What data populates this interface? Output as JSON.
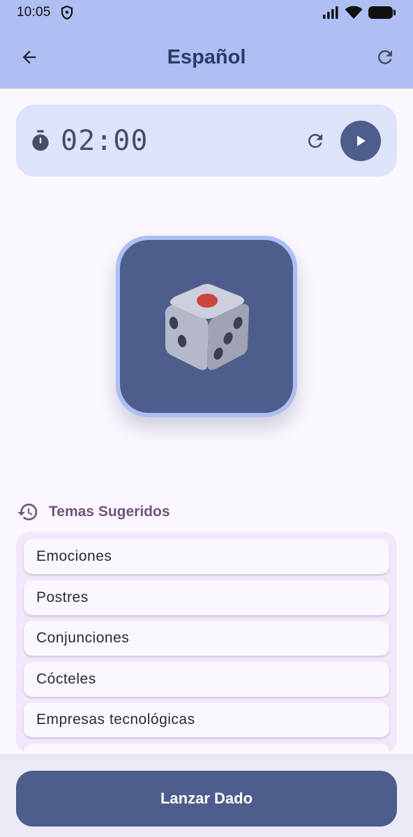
{
  "status_bar": {
    "time": "10:05"
  },
  "app_bar": {
    "title": "Español",
    "back_icon": "arrow-left-icon",
    "refresh_icon": "refresh-icon"
  },
  "timer": {
    "value": "02:00",
    "icon": "stopwatch-icon",
    "reset_icon": "refresh-icon",
    "play_icon": "play-icon"
  },
  "dice": {
    "icon": "dice-icon"
  },
  "suggestions": {
    "title": "Temas Sugeridos",
    "icon": "history-icon",
    "items": [
      {
        "label": "Emociones"
      },
      {
        "label": "Postres"
      },
      {
        "label": "Conjunciones"
      },
      {
        "label": "Cócteles"
      },
      {
        "label": "Empresas tecnológicas"
      }
    ]
  },
  "actions": {
    "roll_label": "Lanzar Dado"
  },
  "colors": {
    "header": "#aebff3",
    "primary": "#4d5e8d",
    "timer_card": "#dde3f8",
    "suggest_panel": "#f3e8fb",
    "suggest_title": "#6f557c"
  }
}
